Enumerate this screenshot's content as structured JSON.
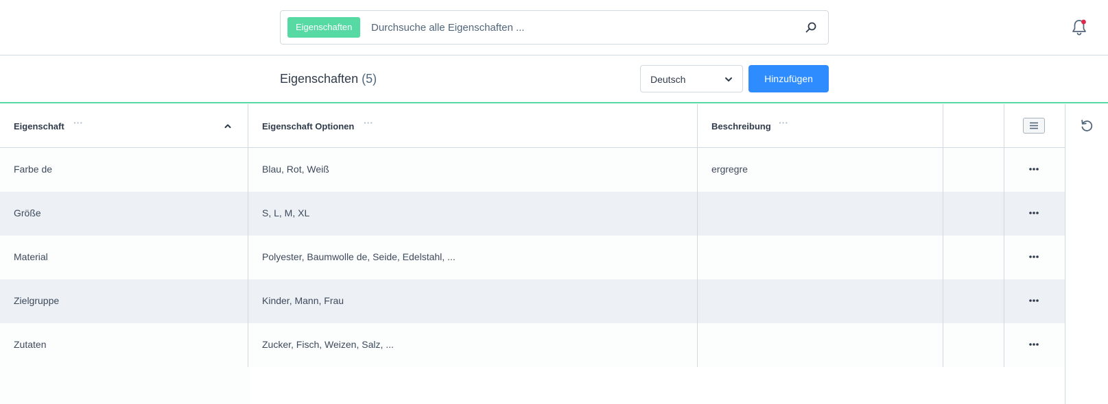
{
  "search": {
    "badge": "Eigenschaften",
    "placeholder": "Durchsuche alle Eigenschaften ...",
    "icon": "search-icon"
  },
  "notifications": {
    "icon": "bell-icon",
    "has_unread": true,
    "dot_color": "#de294c"
  },
  "header": {
    "title": "Eigenschaften",
    "count": "(5)",
    "language": "Deutsch",
    "add_label": "Hinzufügen"
  },
  "colors": {
    "accent_green": "#57d9a3",
    "primary_blue": "#2e8cff",
    "row_alt": "#edf0f4",
    "border": "#d1d9e0"
  },
  "table": {
    "columns": [
      {
        "label": "Eigenschaft",
        "dots": "···",
        "sorted": "ascending"
      },
      {
        "label": "Eigenschaft Optionen",
        "dots": "···"
      },
      {
        "label": "Beschreibung",
        "dots": "···"
      }
    ],
    "rows": [
      {
        "name": "Farbe de",
        "options": "Blau, Rot, Weiß",
        "description": "ergregre"
      },
      {
        "name": "Größe",
        "options": "S, L, M, XL",
        "description": ""
      },
      {
        "name": "Material",
        "options": "Polyester, Baumwolle de, Seide, Edelstahl, ...",
        "description": ""
      },
      {
        "name": "Zielgruppe",
        "options": "Kinder, Mann, Frau",
        "description": ""
      },
      {
        "name": "Zutaten",
        "options": "Zucker, Fisch, Weizen, Salz, ...",
        "description": ""
      }
    ]
  }
}
